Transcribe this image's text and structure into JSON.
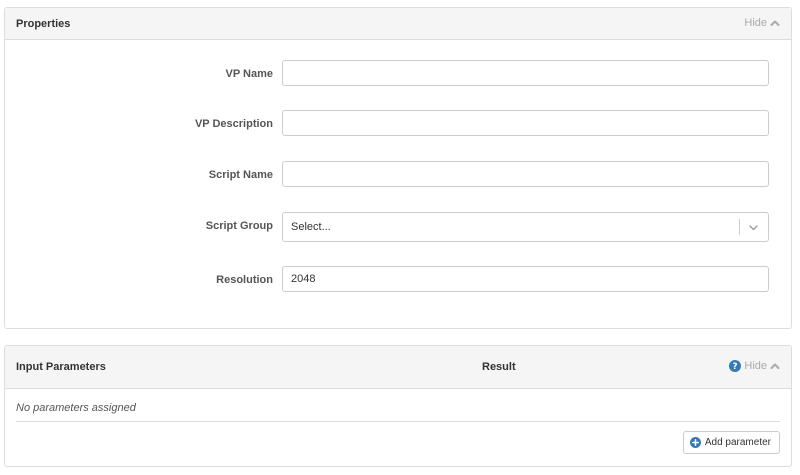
{
  "properties": {
    "title": "Properties",
    "hide_label": "Hide",
    "fields": {
      "vp_name": {
        "label": "VP Name",
        "value": ""
      },
      "vp_description": {
        "label": "VP Description",
        "value": ""
      },
      "script_name": {
        "label": "Script Name",
        "value": ""
      },
      "script_group": {
        "label": "Script Group",
        "value": "Select..."
      },
      "resolution": {
        "label": "Resolution",
        "value": "2048"
      }
    }
  },
  "input_parameters": {
    "title": "Input Parameters",
    "result_label": "Result",
    "hide_label": "Hide",
    "empty_message": "No parameters assigned",
    "add_button_label": "Add parameter"
  },
  "colors": {
    "accent": "#337ab7",
    "muted": "#aaaaaa",
    "border": "#dddddd",
    "heading_bg": "#f5f5f5"
  },
  "icons": {
    "hide": "chevron-up-icon",
    "select": "chevron-down-icon",
    "help": "question-circle-icon",
    "add": "plus-circle-icon"
  }
}
